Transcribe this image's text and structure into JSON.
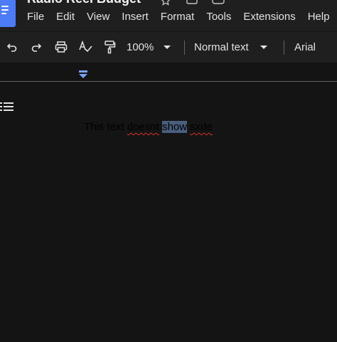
{
  "app": {
    "doc_title": "Radio Reel Budget",
    "title_icons": [
      "star-icon",
      "folder-move-icon",
      "cloud-status-icon"
    ]
  },
  "menubar": {
    "items": [
      "File",
      "Edit",
      "View",
      "Insert",
      "Format",
      "Tools",
      "Extensions",
      "Help"
    ]
  },
  "toolbar": {
    "zoom": "100%",
    "style": "Normal text",
    "font": "Arial",
    "icons": [
      "undo-icon",
      "redo-icon",
      "print-icon",
      "spellcheck-icon",
      "paint-format-icon"
    ]
  },
  "document": {
    "line_parts": [
      "This text ",
      "doesnt",
      " ",
      "show",
      " ",
      "sxde"
    ],
    "selected_word": "show",
    "misspelled": [
      "doesnt",
      "sxde"
    ]
  },
  "colors": {
    "background": "#141414",
    "chrome": "#1f1f1f",
    "accent": "#4d7cf6",
    "selection": "#4a5e7d",
    "spell_underline": "#d93025"
  }
}
